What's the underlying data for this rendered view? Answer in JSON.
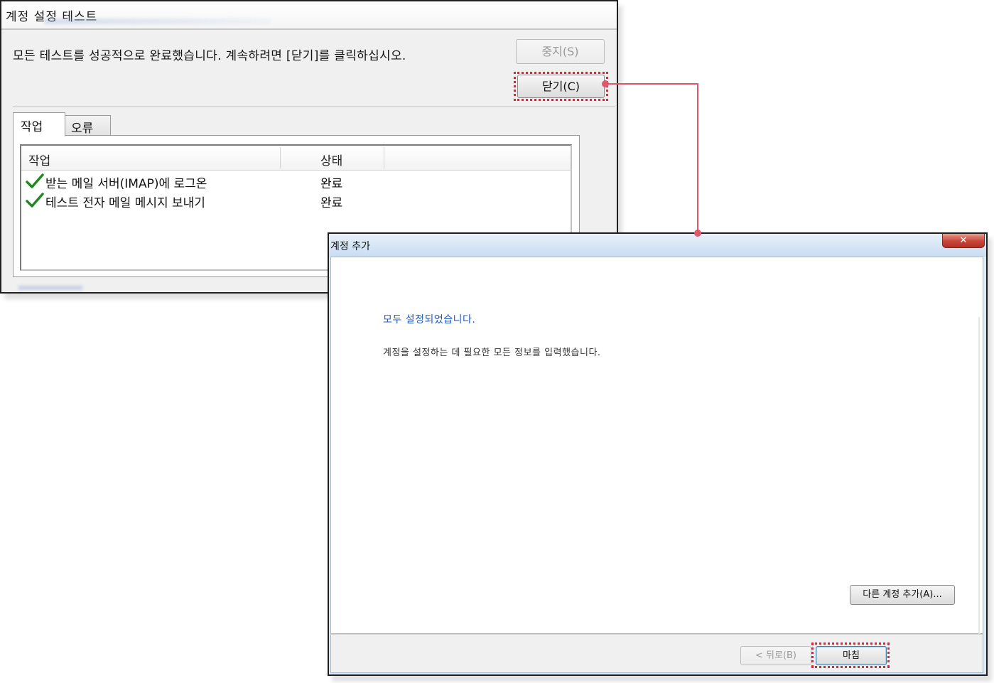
{
  "test_dialog": {
    "title": "계정 설정 테스트",
    "message": "모든 테스트를 성공적으로 완료했습니다. 계속하려면 [닫기]를 클릭하십시오.",
    "stop_button": "중지(S)",
    "close_button": "닫기(C)",
    "tabs": [
      {
        "label": "작업",
        "active": true
      },
      {
        "label": "오류",
        "active": false
      }
    ],
    "columns": [
      "작업",
      "상태"
    ],
    "rows": [
      {
        "task": "받는 메일 서버(IMAP)에 로그온",
        "status": "완료",
        "icon": "checkmark-icon"
      },
      {
        "task": "테스트 전자 메일 메시지 보내기",
        "status": "완료",
        "icon": "checkmark-icon"
      }
    ]
  },
  "add_account_dialog": {
    "title": "계정 추가",
    "close_glyph": "✕",
    "heading": "모두 설정되었습니다.",
    "description": "계정을 설정하는 데 필요한 모든 정보를 입력했습니다.",
    "add_another_button": "다른 계정 추가(A)...",
    "back_button": "< 뒤로(B)",
    "finish_button": "마침"
  },
  "colors": {
    "highlight": "#d6293c",
    "connector": "#e0566a",
    "heading_blue": "#1f5bc4",
    "check_green": "#1f8a1f"
  }
}
